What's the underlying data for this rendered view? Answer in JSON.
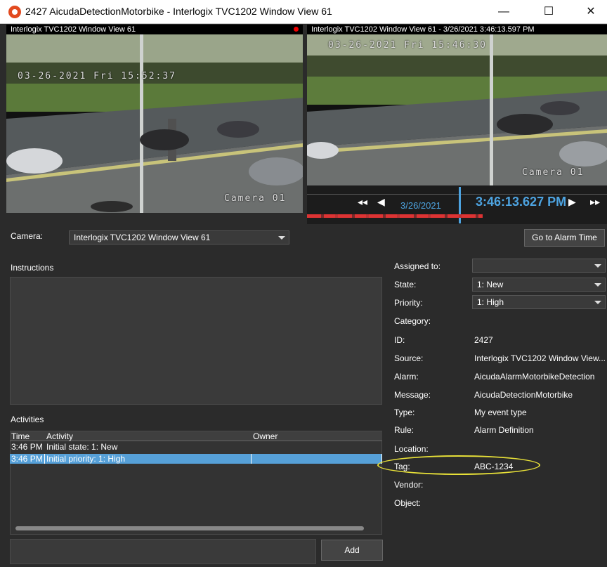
{
  "window": {
    "title": "2427 AicudaDetectionMotorbike - Interlogix TVC1202 Window View 61",
    "minimize_icon": "—",
    "maximize_icon": "☐",
    "close_icon": "✕"
  },
  "left_video": {
    "label": "Interlogix TVC1202 Window View 61",
    "osd_datetime": "03-26-2021 Fri 15:52:37",
    "osd_camera": "Camera 01"
  },
  "right_video": {
    "label": "Interlogix TVC1202 Window View 61 - 3/26/2021 3:46:13.597 PM",
    "osd_datetime": "03-26-2021 Fri 15:46:30",
    "osd_camera": "Camera 01"
  },
  "playback": {
    "prev_icon": "◂◂",
    "back_icon": "◀",
    "date": "3/26/2021",
    "time": "3:46:13.627 PM",
    "play_icon": "▶",
    "next_icon": "▸▸"
  },
  "camera": {
    "label": "Camera:",
    "selected": "Interlogix TVC1202 Window View 61",
    "goto_button": "Go to Alarm Time"
  },
  "instructions": {
    "label": "Instructions"
  },
  "activities": {
    "label": "Activities",
    "columns": [
      "Time",
      "Activity",
      "Owner"
    ],
    "rows": [
      {
        "time": "3:46 PM",
        "activity": "Initial state: 1: New",
        "owner": ""
      },
      {
        "time": "3:46 PM",
        "activity": "Initial priority: 1: High",
        "owner": ""
      }
    ],
    "add_button": "Add"
  },
  "details": {
    "assigned_to_label": "Assigned to:",
    "assigned_to_value": "",
    "state_label": "State:",
    "state_value": "1: New",
    "priority_label": "Priority:",
    "priority_value": "1: High",
    "category_label": "Category:",
    "id_label": "ID:",
    "id_value": "2427",
    "source_label": "Source:",
    "source_value": "Interlogix TVC1202 Window View...",
    "alarm_label": "Alarm:",
    "alarm_value": "AicudaAlarmMotorbikeDetection",
    "message_label": "Message:",
    "message_value": "AicudaDetectionMotorbike",
    "type_label": "Type:",
    "type_value": "My event type",
    "rule_label": "Rule:",
    "rule_value": "Alarm Definition",
    "location_label": "Location:",
    "tag_label": "Tag:",
    "tag_value": "ABC-1234",
    "vendor_label": "Vendor:",
    "object_label": "Object:"
  },
  "colors": {
    "accent": "#4da3e0",
    "selection": "#56a0d8",
    "highlight_ellipse": "#e7e038",
    "record_dot": "#e00000"
  }
}
